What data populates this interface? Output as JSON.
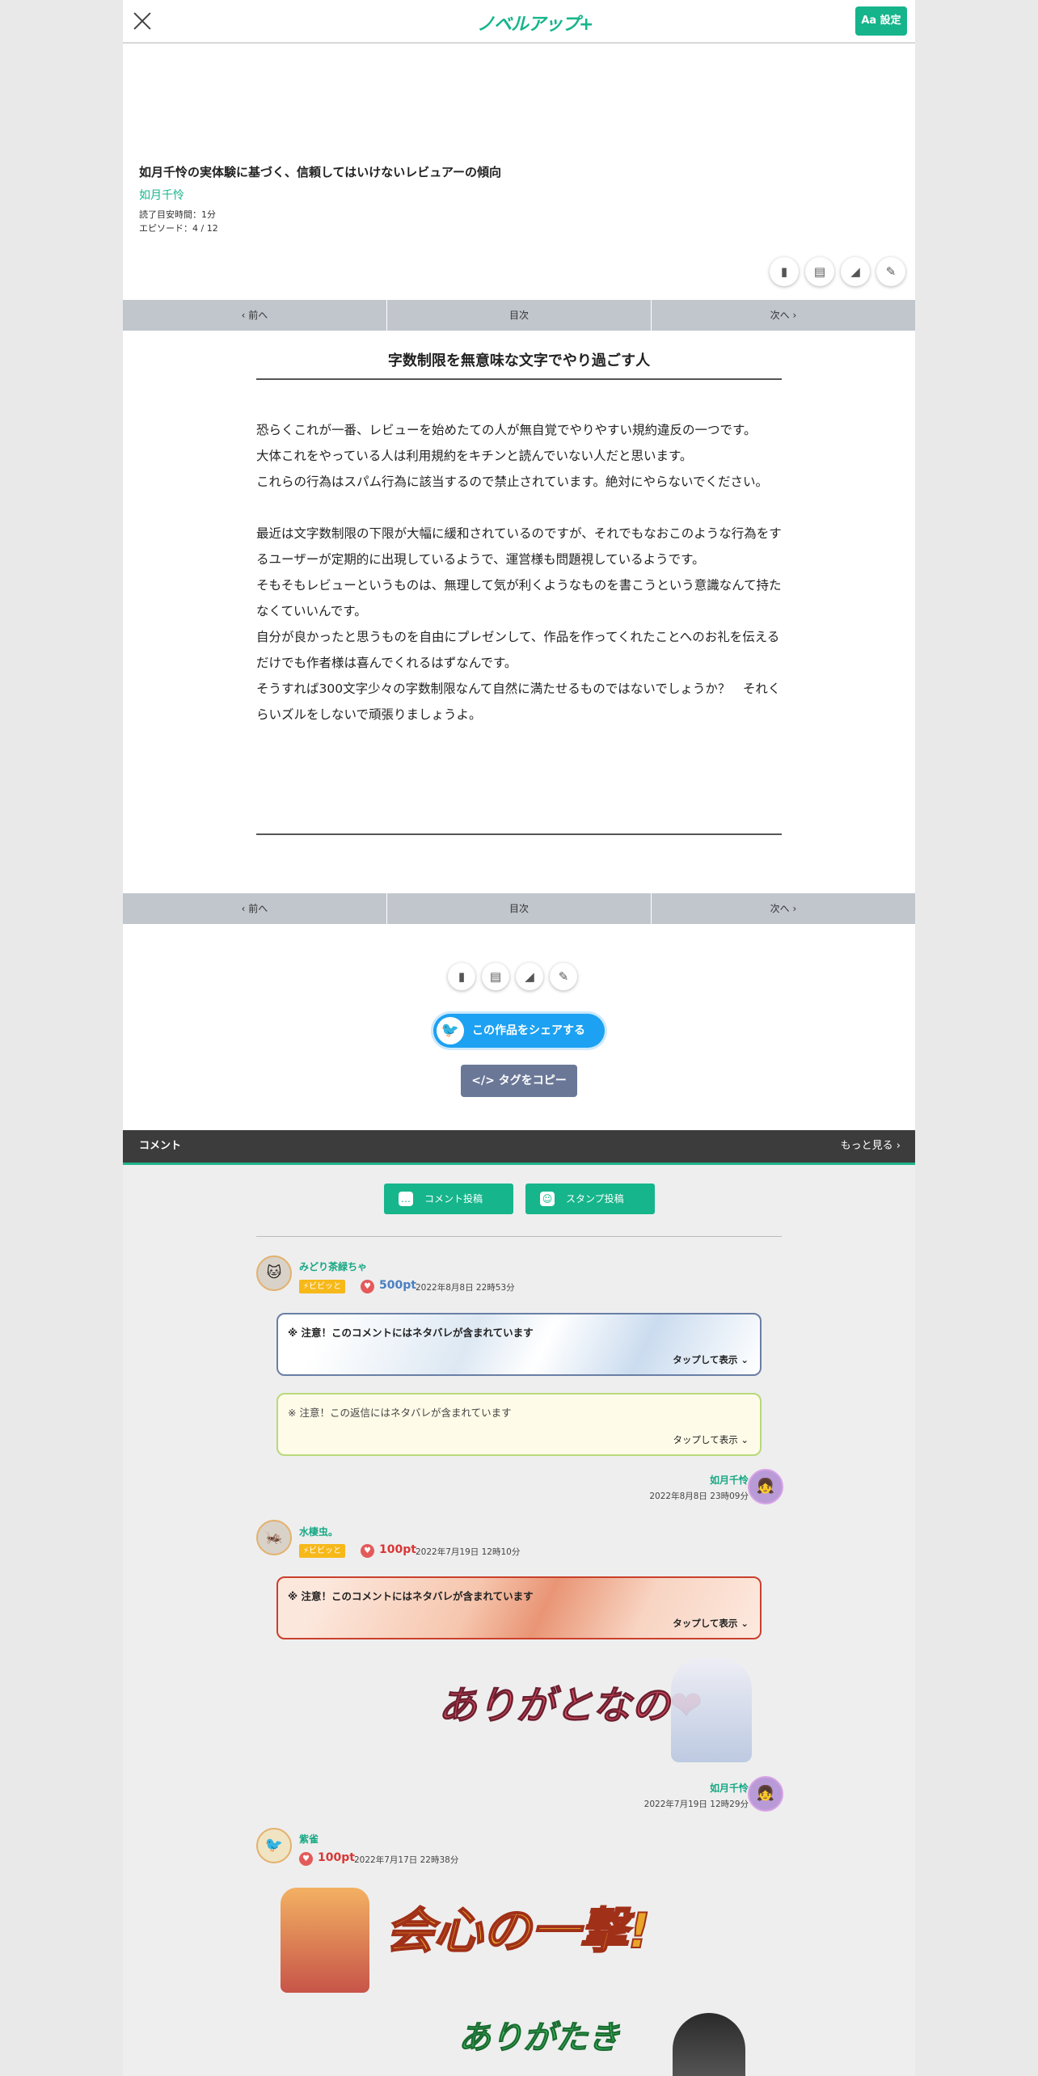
{
  "header": {
    "logo_text": "ノベルアップ+",
    "settings_label": "Aa 設定"
  },
  "work": {
    "title": "如月千怜の実体験に基づく、信頼してはいけないレビュアーの傾向",
    "author": "如月千怜",
    "reading_time": "読了目安時間：1分",
    "episode": "エピソード：4 / 12"
  },
  "nav": {
    "prev": "前へ",
    "toc": "目次",
    "next": "次へ"
  },
  "episode": {
    "title": "字数制限を無意味な文字でやり過ごす人",
    "para1": [
      "恐らくこれが一番、レビューを始めたての人が無自覚でやりやすい規約違反の一つです。",
      "大体これをやっている人は利用規約をキチンと読んでいない人だと思います。",
      "これらの行為はスパム行為に該当するので禁止されています。絶対にやらないでください。"
    ],
    "para2": [
      "最近は文字数制限の下限が大幅に緩和されているのですが、それでもなおこのような行為をするユーザーが定期的に出現しているようで、運営様も問題視しているようです。",
      "そもそもレビューというものは、無理して気が利くようなものを書こうという意識なんて持たなくていいんです。",
      "自分が良かったと思うものを自由にプレゼンして、作品を作ってくれたことへのお礼を伝えるだけでも作者様は喜んでくれるはずなんです。",
      "そうすれば300文字少々の字数制限なんて自然に満たせるものではないでしょうか？　それくらいズルをしないで頑張りましょうよ。"
    ]
  },
  "actions": {
    "share_label": "この作品をシェアする",
    "tag_label": "タグをコピー"
  },
  "comments": {
    "header": "コメント",
    "more": "もっと見る",
    "post_comment": "コメント投稿",
    "post_stamp": "スタンプ投稿",
    "tap_to_show": "タップして表示",
    "items": [
      {
        "user": "みどり茶緑ちゃ",
        "badge": "ビビッと",
        "points": "500pt",
        "date": "2022年8月8日 22時53分",
        "spoiler": "※ 注意！このコメントにはネタバレが含まれています",
        "reply": {
          "text": "※ 注意！この返信にはネタバレが含まれています",
          "user": "如月千怜",
          "date": "2022年8月8日 23時09分"
        }
      },
      {
        "user": "水棲虫。",
        "badge": "ビビッと",
        "points": "100pt",
        "date": "2022年7月19日 12時10分",
        "spoiler": "※ 注意！このコメントにはネタバレが含まれています",
        "reply": {
          "stamp": "ありがとなの",
          "user": "如月千怜",
          "date": "2022年7月19日 12時29分"
        }
      },
      {
        "user": "紫雀",
        "points": "100pt",
        "date": "2022年7月17日 22時38分",
        "stamp1": "会心の一撃!",
        "stamp2": "ありがたき"
      }
    ]
  },
  "colors": {
    "brand_green": "#16b58b",
    "twitter_blue": "#1da1f2",
    "nav_gray": "#c1c6cd",
    "points_blue": "#4a7fc1",
    "points_red": "#d93636"
  }
}
